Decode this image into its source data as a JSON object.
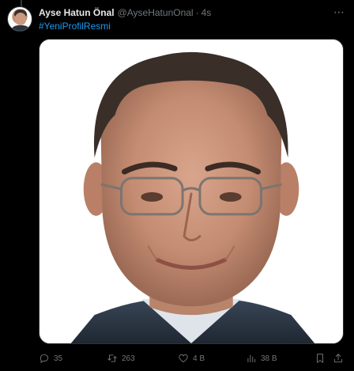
{
  "tweet": {
    "display_name": "Ayse Hatun Önal",
    "handle": "@AyseHatunOnal",
    "separator": "·",
    "time": "4s",
    "hashtag": "#YeniProfilResmi"
  },
  "actions": {
    "replies": "35",
    "retweets": "263",
    "likes": "4 B",
    "views": "38 B"
  },
  "colors": {
    "background": "#000000",
    "text_primary": "#e7e9ea",
    "text_secondary": "#71767b",
    "link": "#1d9bf0"
  },
  "icons": {
    "more": "more-icon",
    "reply": "reply-icon",
    "retweet": "retweet-icon",
    "like": "heart-icon",
    "views": "views-chart-icon",
    "bookmark": "bookmark-icon",
    "share": "share-icon"
  }
}
